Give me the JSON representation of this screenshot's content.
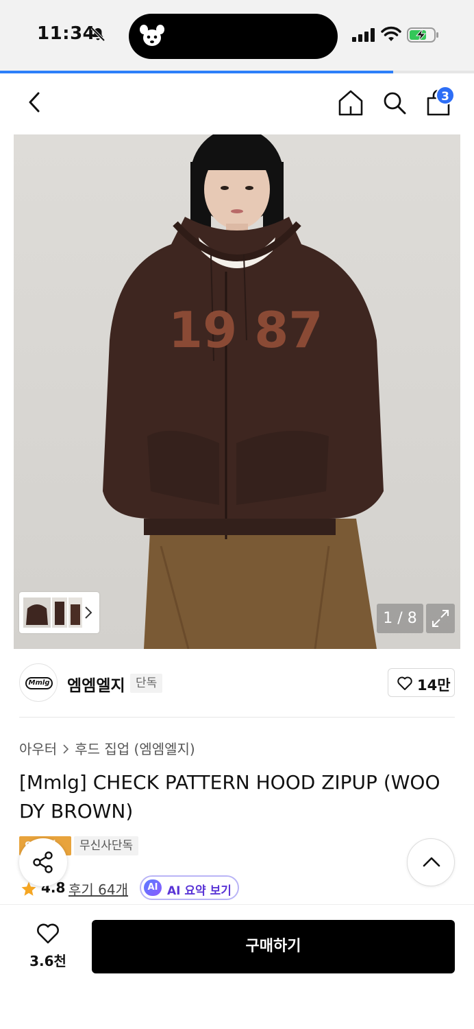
{
  "status_bar": {
    "time": "11:34",
    "icons": [
      "bell-off-icon",
      "signal-icon",
      "wifi-icon",
      "battery-charging-icon"
    ]
  },
  "page_progress": 0.83,
  "nav": {
    "cart_count": "3",
    "icons": [
      "back-icon",
      "home-icon",
      "search-icon",
      "shopping-bag-icon"
    ]
  },
  "gallery": {
    "pager": "1 / 8",
    "hero_print": "19 87"
  },
  "brand": {
    "logo_text": "Mmlg",
    "name": "엠엠엘지",
    "exclusive_tag": "단독",
    "likes": "14만"
  },
  "breadcrumb": {
    "category": "아우터",
    "subcategory": "후드 집업 (엠엠엘지)"
  },
  "product": {
    "title": "[Mmlg] CHECK PATTERN HOOD ZIPUP (WOODY BROWN)",
    "coupon_tag": "9 할인",
    "musinsa_tag": "무신사단독"
  },
  "reviews": {
    "rating": "4.8",
    "review_link": "후기 64개",
    "ai_badge": "AI",
    "ai_summary": "AI 요약 보기"
  },
  "bottom_bar": {
    "wish_count": "3.6천",
    "buy_label": "구매하기"
  },
  "colors": {
    "accent_blue": "#2d6ef6",
    "coupon_orange": "#e8a33c",
    "ai_purple": "#5a35d6",
    "buy_button": "#000000"
  }
}
